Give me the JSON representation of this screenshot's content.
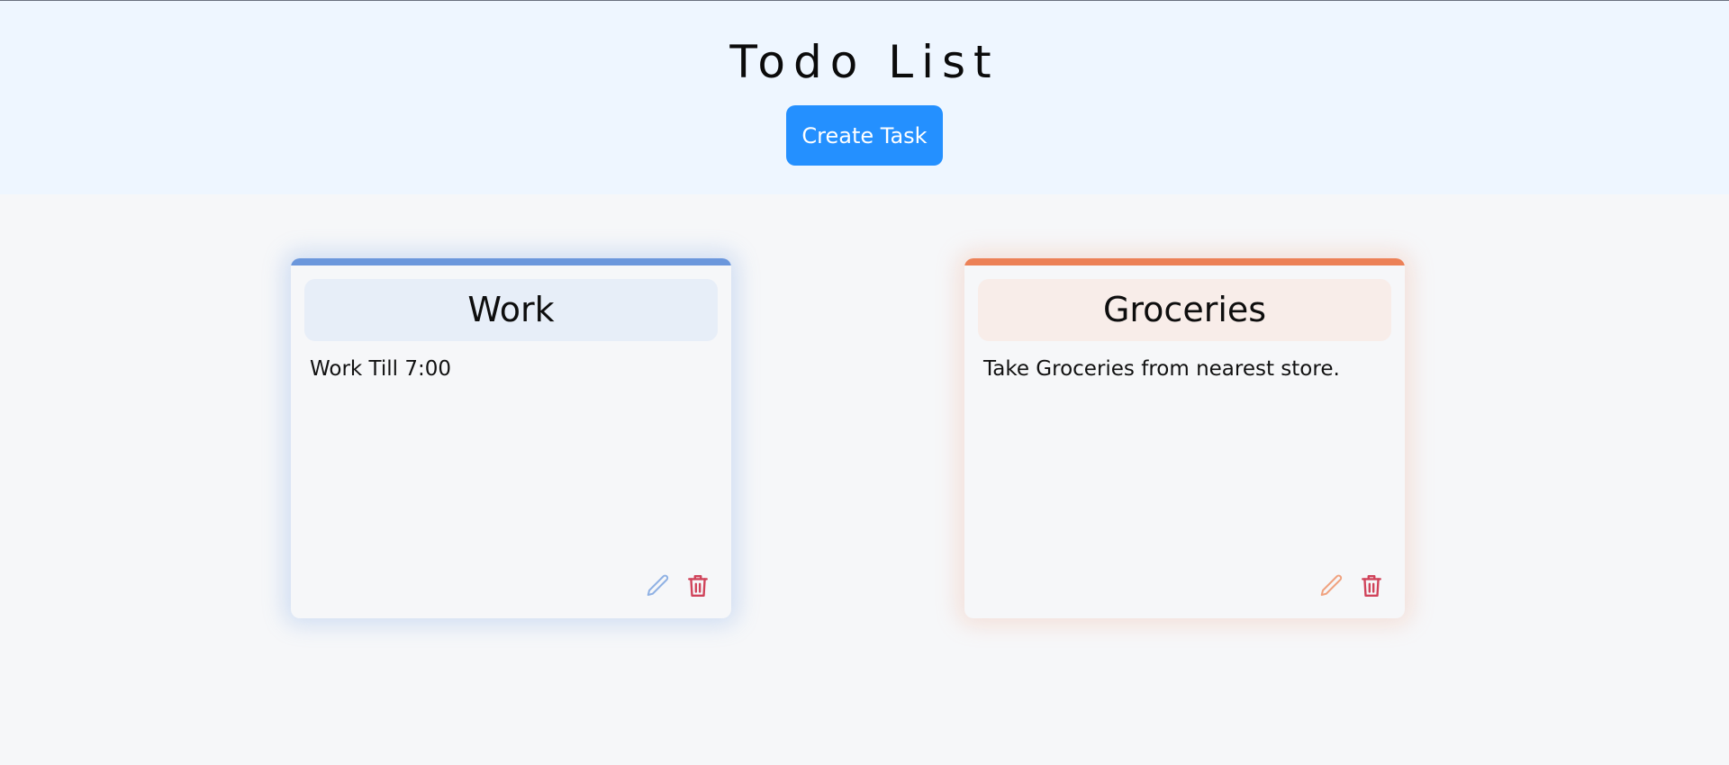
{
  "header": {
    "title": "Todo List",
    "create_label": "Create Task"
  },
  "colors": {
    "header_bg": "#eef6ff",
    "page_bg": "#f6f7f9",
    "create_button": "#2490ff",
    "delete_icon": "#d0435a"
  },
  "cards": [
    {
      "category": "Work",
      "description": "Work Till 7:00",
      "accent": "#6b97dc",
      "head_bg": "#e7eef8",
      "edit_icon": "pencil-icon",
      "delete_icon": "trash-icon"
    },
    {
      "category": "Groceries",
      "description": "Take Groceries from nearest store.",
      "accent": "#ec8157",
      "head_bg": "#f8ede9",
      "edit_icon": "pencil-icon",
      "delete_icon": "trash-icon"
    }
  ]
}
